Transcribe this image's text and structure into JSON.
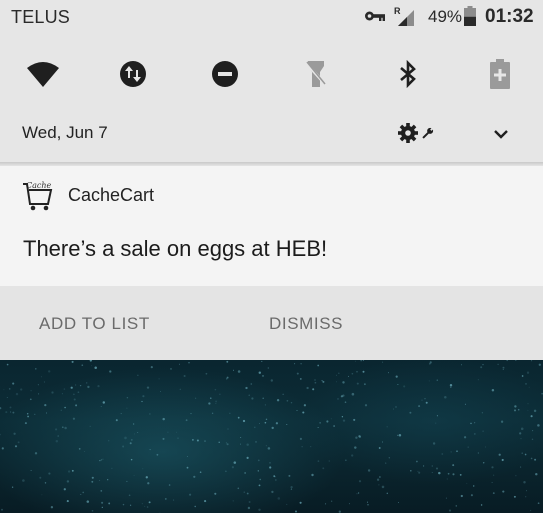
{
  "status_bar": {
    "carrier": "TELUS",
    "roaming_indicator": "R",
    "battery_percent": "49%",
    "time": "01:32",
    "icons": [
      "vpn-key-icon",
      "cell-signal-icon",
      "battery-icon"
    ]
  },
  "quick_settings": {
    "tiles": [
      "wifi-icon",
      "data-transfer-icon",
      "do-not-disturb-icon",
      "flashlight-icon",
      "bluetooth-icon",
      "battery-saver-icon"
    ],
    "date": "Wed, Jun 7"
  },
  "notification": {
    "app_name": "CacheCart",
    "app_icon_text": "Cache Cart",
    "message": "There’s a sale on eggs at HEB!",
    "actions": {
      "add_to_list": "ADD TO LIST",
      "dismiss": "DISMISS"
    }
  },
  "colors": {
    "panel_bg": "#e6e6e6",
    "notification_bg": "#f4f4f4",
    "actions_bg": "#e4e4e4",
    "wallpaper_accent": "#1e5f6e"
  }
}
